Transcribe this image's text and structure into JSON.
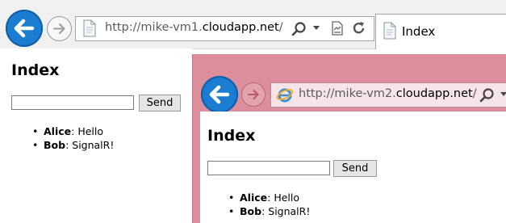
{
  "window1": {
    "url_prefix": "http://mike-vm1.",
    "url_domain": "cloudapp.net",
    "url_suffix": "/",
    "tab_title": "Index",
    "page": {
      "heading": "Index",
      "input_value": "",
      "send_label": "Send",
      "messages": [
        {
          "name": "Alice",
          "text": ": Hello"
        },
        {
          "name": "Bob",
          "text": ": SignalR!"
        }
      ]
    }
  },
  "window2": {
    "url_prefix": "http://mike-vm2.",
    "url_domain": "cloudapp.net",
    "url_suffix": "/",
    "page": {
      "heading": "Index",
      "input_value": "",
      "send_label": "Send",
      "messages": [
        {
          "name": "Alice",
          "text": ": Hello"
        },
        {
          "name": "Bob",
          "text": ": SignalR!"
        }
      ]
    }
  },
  "colors": {
    "accent": "#1a7dd1",
    "window2_frame": "#dc8e9c"
  },
  "icons": [
    "back-arrow-icon",
    "forward-arrow-icon",
    "page-icon",
    "search-icon",
    "dropdown-icon",
    "compatibility-icon",
    "refresh-icon",
    "ie-icon"
  ]
}
